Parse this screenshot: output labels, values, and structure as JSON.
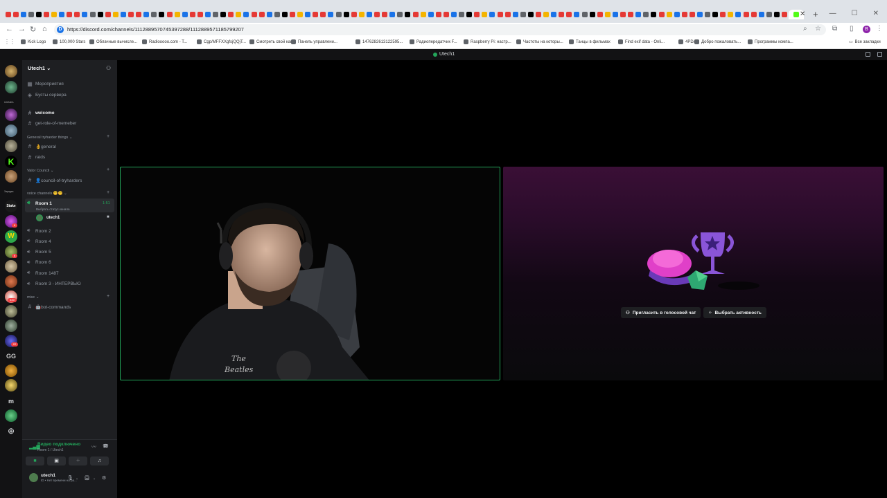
{
  "browser": {
    "url": "https://discord.com/channels/1112889570745397288/1112889571185799207",
    "bookmarks": [
      "Kick Logo",
      "100,000 Stars",
      "Облачные вычисле...",
      "Radiooooo.com - T...",
      "Cgp/MFFXXgfsjQQjT...",
      "Смотреть свой кан...",
      "Панель управлени...",
      "1476282613122595...",
      "Радиопередатчик F...",
      "Raspberry Pi: настр...",
      "Частоты на которы...",
      "Танцы в фильмах",
      "Find exif data - Onli...",
      "4PDA",
      "Добро пожаловать...",
      "Программы компа..."
    ],
    "all_bookmarks": "Все закладки",
    "profile_initial": "B"
  },
  "window": {
    "title": "Utech1"
  },
  "server": {
    "name": "Utech1",
    "top_items": [
      "Мероприятия",
      "Бусты сервера"
    ],
    "channels_top": [
      {
        "name": "welcome",
        "selected": true
      },
      {
        "name": "get-role-of-memeber",
        "selected": false
      }
    ],
    "categories": [
      {
        "name": "General tryharder things",
        "channels": [
          "👌general",
          "raids"
        ]
      },
      {
        "name": "Valor Council",
        "channels": [
          "👤council-of-tryharders"
        ]
      },
      {
        "name": "voice channels 😊😊",
        "voice": true
      },
      {
        "name": "misc",
        "channels": [
          "🤖bot-commands"
        ]
      }
    ],
    "voice_room": {
      "name": "Room 1",
      "timer": "1:51",
      "status": "Выбрать статус канала",
      "member": "utech1"
    },
    "other_rooms": [
      "Room 2",
      "Room 4",
      "Room 5",
      "Room 6",
      "Room 1487",
      "Room 3 - ИНТЕРВЬЮ"
    ]
  },
  "voice_panel": {
    "status": "Видео подключено",
    "location": "Room 1 / Utech1"
  },
  "user_panel": {
    "name": "utech1",
    "status": "ID • Нет времени на ра..."
  },
  "guild_labels": {
    "top": "UMANIA",
    "mid": "Зарядка"
  },
  "guild_badges": [
    "6",
    "6",
    "540",
    "22"
  ],
  "guild_letters": {
    "gg": "GG",
    "m": "m"
  },
  "activity": {
    "invite_label": "Пригласить в голосовой чат",
    "choose_label": "Выбрать активность"
  },
  "colors": {
    "accent_green": "#23a55a",
    "discord_dark": "#1e1f22",
    "activity_purple": "#3a0f36"
  }
}
